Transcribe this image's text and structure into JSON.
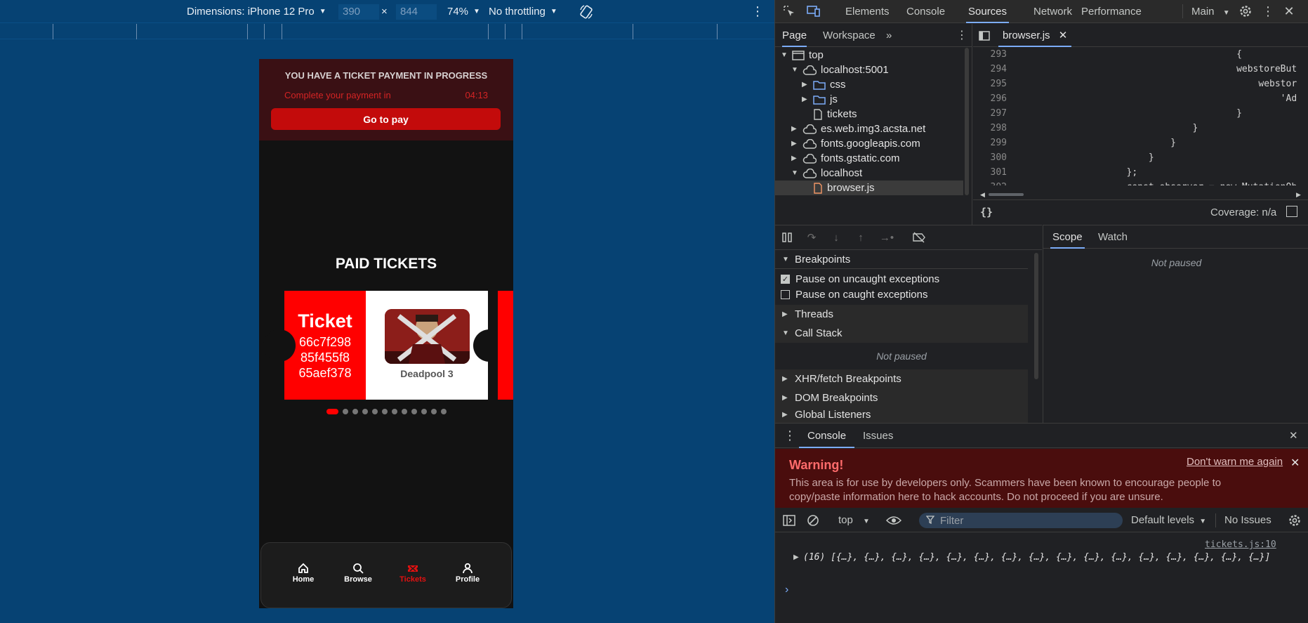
{
  "device_toolbar": {
    "dimensions_label": "Dimensions: iPhone 12 Pro",
    "width": "390",
    "times": "×",
    "height": "844",
    "zoom": "74%",
    "throttling": "No throttling"
  },
  "app": {
    "banner_title": "YOU HAVE A TICKET PAYMENT IN PROGRESS",
    "banner_subtitle": "Complete your payment in",
    "timer": "04:13",
    "go_pay": "Go to pay",
    "section_title": "PAID TICKETS",
    "ticket_word": "Ticket",
    "ticket_id_lines": [
      "66c7f298",
      "85f455f8",
      "65aef378"
    ],
    "movie_name": "Deadpool 3",
    "carousel_total": 12,
    "carousel_active": 0,
    "nav": [
      {
        "label": "Home",
        "icon": "home-icon",
        "active": false
      },
      {
        "label": "Browse",
        "icon": "search-icon",
        "active": false
      },
      {
        "label": "Tickets",
        "icon": "ticket-icon",
        "active": true
      },
      {
        "label": "Profile",
        "icon": "user-icon",
        "active": false
      }
    ]
  },
  "devtools": {
    "tabs": [
      "Elements",
      "Console",
      "Sources",
      "Network",
      "Performance"
    ],
    "active_tab": "Sources",
    "context": "Main",
    "nav_tabs": [
      "Page",
      "Workspace"
    ],
    "tree": [
      {
        "label": "top",
        "type": "frame",
        "indent": 0,
        "expanded": true
      },
      {
        "label": "localhost:5001",
        "type": "cloud",
        "indent": 1,
        "expanded": true
      },
      {
        "label": "css",
        "type": "folder",
        "indent": 2,
        "expanded": false
      },
      {
        "label": "js",
        "type": "folder",
        "indent": 2,
        "expanded": false
      },
      {
        "label": "tickets",
        "type": "file",
        "indent": 2,
        "expanded": null
      },
      {
        "label": "es.web.img3.acsta.net",
        "type": "cloud",
        "indent": 1,
        "expanded": false
      },
      {
        "label": "fonts.googleapis.com",
        "type": "cloud",
        "indent": 1,
        "expanded": false
      },
      {
        "label": "fonts.gstatic.com",
        "type": "cloud",
        "indent": 1,
        "expanded": false
      },
      {
        "label": "localhost",
        "type": "cloud",
        "indent": 1,
        "expanded": true
      },
      {
        "label": "browser.js",
        "type": "jsfile",
        "indent": 2,
        "expanded": null
      }
    ],
    "file_tab": "browser.js",
    "code": [
      {
        "n": "293",
        "text": "                                        {"
      },
      {
        "n": "294",
        "text": "                                        webstoreBut"
      },
      {
        "n": "295",
        "text": "                                            webstor"
      },
      {
        "n": "296",
        "text": "                                                'Ad"
      },
      {
        "n": "297",
        "text": "                                        }"
      },
      {
        "n": "298",
        "text": "                                }"
      },
      {
        "n": "299",
        "text": "                            }"
      },
      {
        "n": "300",
        "text": "                        }"
      },
      {
        "n": "301",
        "text": "                    };"
      },
      {
        "n": "302",
        "text": "                    const observer = new MutationOb"
      }
    ],
    "coverage": "Coverage: n/a",
    "breakpoints_title": "Breakpoints",
    "pause_uncaught": "Pause on uncaught exceptions",
    "pause_caught": "Pause on caught exceptions",
    "threads": "Threads",
    "call_stack": "Call Stack",
    "not_paused": "Not paused",
    "xhr": "XHR/fetch Breakpoints",
    "dom": "DOM Breakpoints",
    "global": "Global Listeners",
    "scope_tab": "Scope",
    "watch_tab": "Watch",
    "drawer_tabs": [
      "Console",
      "Issues"
    ],
    "warning_title": "Warning!",
    "warning_text": "This area is for use by developers only. Scammers have been known to encourage people to copy/paste information here to hack accounts. Do not proceed if you are unsure.",
    "dont_warn": "Don't warn me again",
    "context_select": "top",
    "filter_placeholder": "Filter",
    "default_levels": "Default levels",
    "no_issues": "No Issues",
    "log_source": "tickets.js:10",
    "log_text": "(16) [{…}, {…}, {…}, {…}, {…}, {…}, {…}, {…}, {…}, {…}, {…}, {…}, {…}, {…}, {…}, {…}]"
  },
  "colors": {
    "device_bg": "#064273",
    "accent_red": "#ff0000",
    "devtools_bg": "#202124"
  }
}
